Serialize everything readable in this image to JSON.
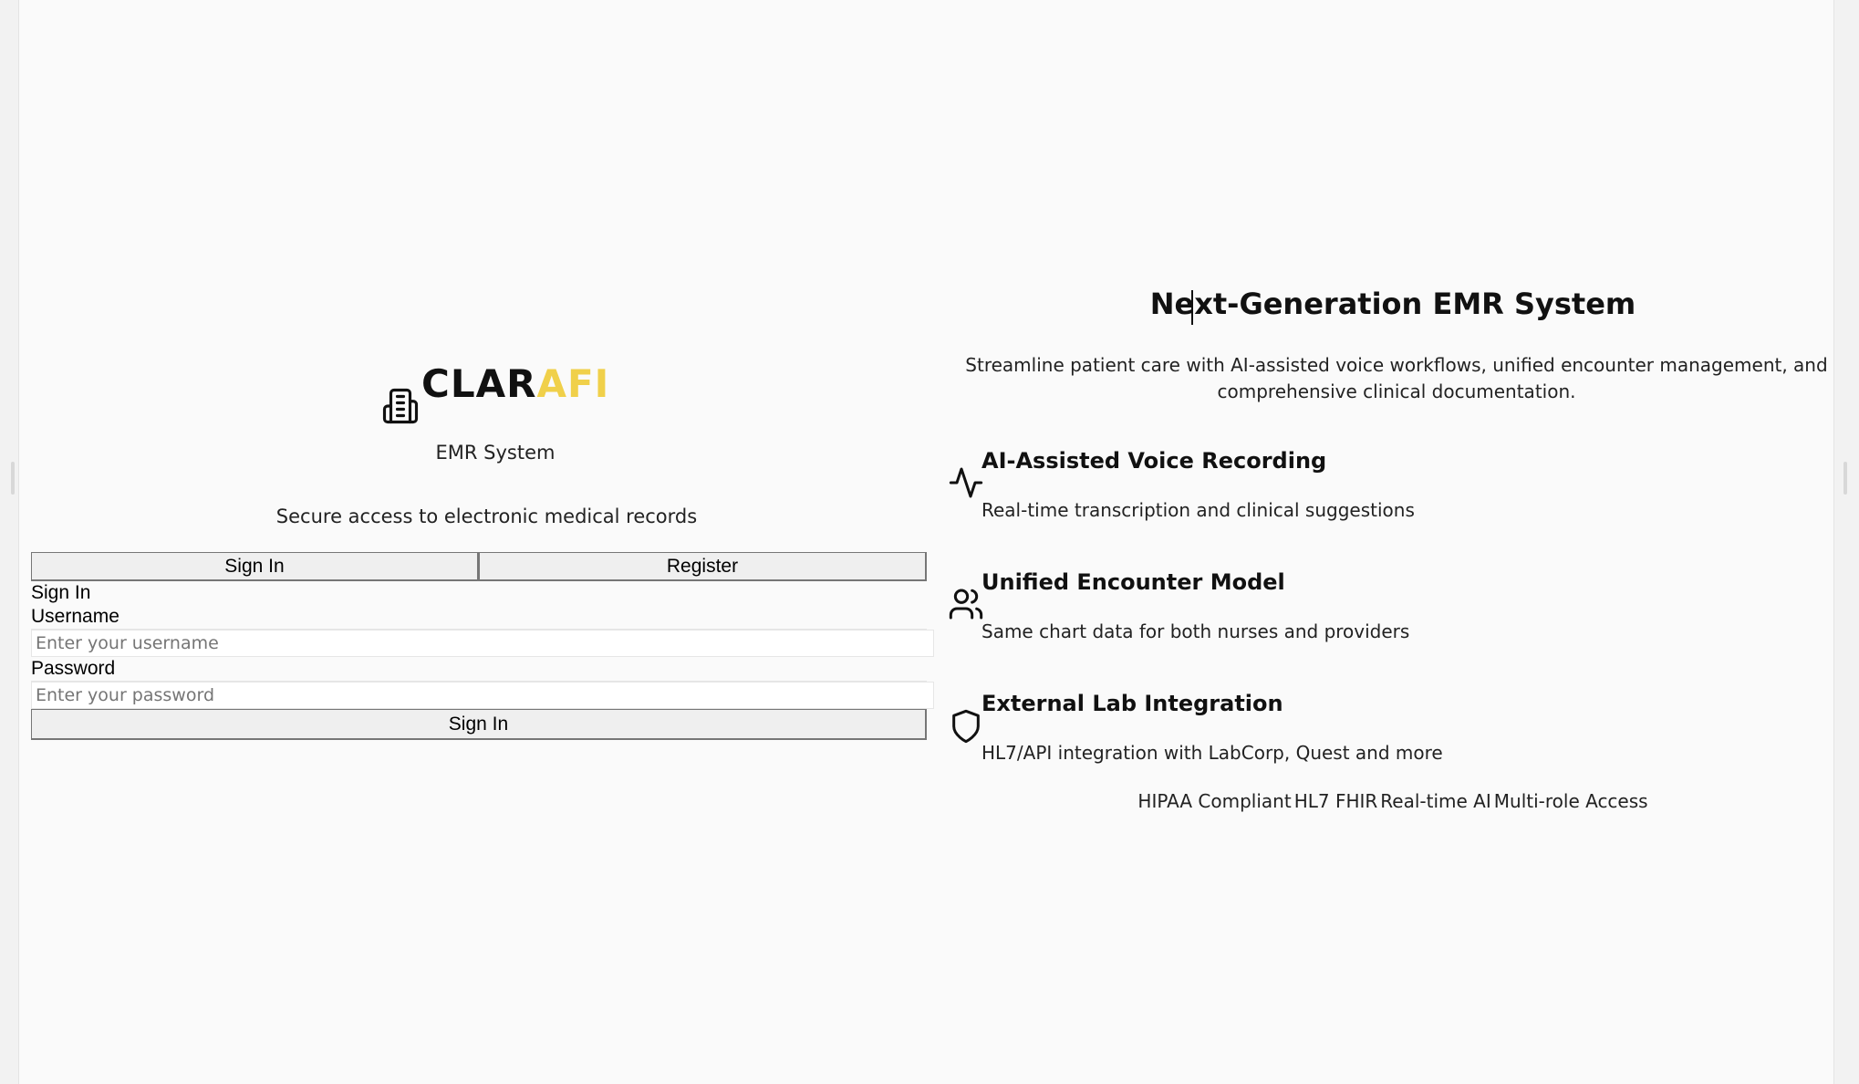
{
  "brand": {
    "name_dark": "CLAR",
    "name_accent": "AFI",
    "subtitle": "EMR System",
    "accent_color": "#f0d04a",
    "icon": "hospital-building-icon"
  },
  "login": {
    "tagline": "Secure access to electronic medical records",
    "tabs": [
      {
        "label": "Sign In"
      },
      {
        "label": "Register"
      }
    ],
    "form": {
      "heading": "Sign In",
      "username": {
        "label": "Username",
        "placeholder": "Enter your username",
        "value": ""
      },
      "password": {
        "label": "Password",
        "placeholder": "Enter your password",
        "value": ""
      },
      "submit_label": "Sign In"
    }
  },
  "hero": {
    "title": "Next-Generation EMR System",
    "description": "Streamline patient care with AI-assisted voice workflows, unified encounter management, and comprehensive clinical documentation."
  },
  "features": [
    {
      "icon": "activity-pulse-icon",
      "title": "AI-Assisted Voice Recording",
      "description": "Real-time transcription and clinical suggestions"
    },
    {
      "icon": "users-icon",
      "title": "Unified Encounter Model",
      "description": "Same chart data for both nurses and providers"
    },
    {
      "icon": "shield-icon",
      "title": "External Lab Integration",
      "description": "HL7/API integration with LabCorp, Quest and more"
    }
  ],
  "badges": [
    "HIPAA Compliant",
    "HL7 FHIR",
    "Real-time AI",
    "Multi-role Access"
  ]
}
